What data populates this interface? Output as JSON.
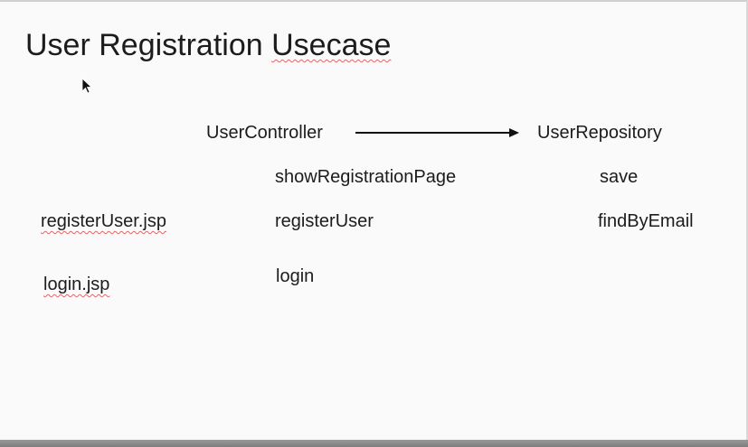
{
  "slide": {
    "title_main": "User Registration",
    "title_underlined": "Usecase"
  },
  "diagram": {
    "controller": "UserController",
    "repository": "UserRepository",
    "controller_methods": [
      "showRegistrationPage",
      "registerUser",
      "login"
    ],
    "repository_methods": [
      "save",
      "findByEmail"
    ],
    "views": [
      "registerUser.jsp",
      "login.jsp"
    ]
  },
  "icons": {
    "cursor": "mouse-pointer-icon",
    "arrow": "right-arrow-icon"
  },
  "colors": {
    "background": "#fafafa",
    "text": "#1c1c1c",
    "spellcheck": "#e06666"
  }
}
